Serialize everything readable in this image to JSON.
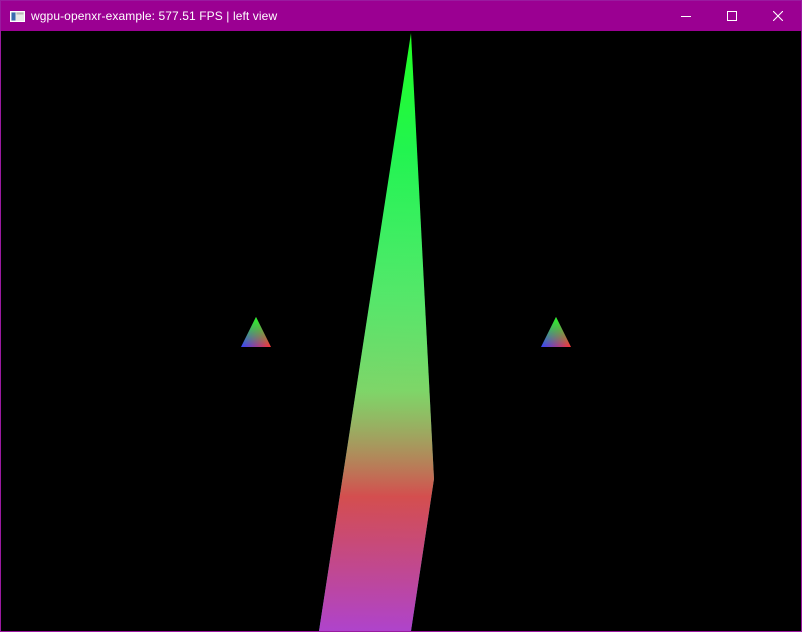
{
  "window": {
    "title": "wgpu-openxr-example: 577.51 FPS | left view",
    "titlebar_color": "#9b0092",
    "icons": {
      "app": "app-window-icon",
      "minimize": "minimize-icon",
      "maximize": "maximize-icon",
      "close": "close-icon"
    }
  },
  "scene": {
    "background": "#000000",
    "objects": [
      "large-rgb-triangle",
      "small-rgb-triangle-left",
      "small-rgb-triangle-right"
    ]
  }
}
